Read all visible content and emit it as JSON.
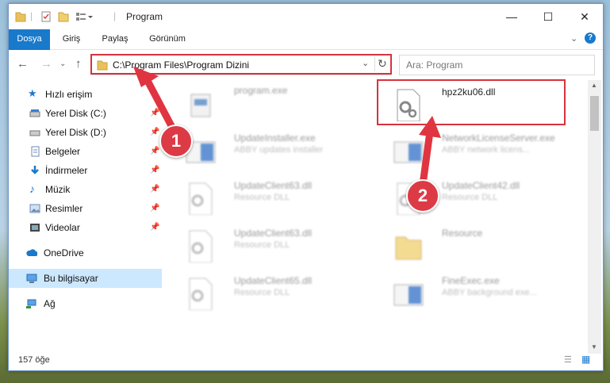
{
  "window": {
    "title": "Program"
  },
  "ribbon": {
    "tabs": [
      "Dosya",
      "Giriş",
      "Paylaş",
      "Görünüm"
    ]
  },
  "address": {
    "path": "C:\\Program Files\\Program Dizini"
  },
  "search": {
    "placeholder": "Ara: Program"
  },
  "nav": {
    "items": [
      "Hızlı erişim",
      "Yerel Disk (C:)",
      "Yerel Disk (D:)",
      "Belgeler",
      "İndirmeler",
      "Müzik",
      "Resimler",
      "Videolar",
      "OneDrive",
      "Bu bilgisayar",
      "Ağ"
    ]
  },
  "files": [
    {
      "name": "program.exe",
      "desc": ""
    },
    {
      "name": "hpz2ku06.dll",
      "desc": ""
    },
    {
      "name": "UpdateInstaller.exe",
      "desc": "ABBY updates installer"
    },
    {
      "name": "NetworkLicenseServer.exe",
      "desc": "ABBY network licens..."
    },
    {
      "name": "UpdateClient63.dll",
      "desc": "Resource DLL"
    },
    {
      "name": "UpdateClient42.dll",
      "desc": "Resource DLL"
    },
    {
      "name": "UpdateClient63.dll",
      "desc": "Resource DLL"
    },
    {
      "name": "Resource",
      "desc": ""
    },
    {
      "name": "UpdateClient65.dll",
      "desc": "Resource DLL"
    },
    {
      "name": "FineExec.exe",
      "desc": "ABBY background exe..."
    }
  ],
  "status": {
    "count": "157 öğe"
  },
  "annotations": {
    "step1": "1",
    "step2": "2"
  },
  "colors": {
    "accent": "#1979ca",
    "highlight": "#d6333d"
  }
}
